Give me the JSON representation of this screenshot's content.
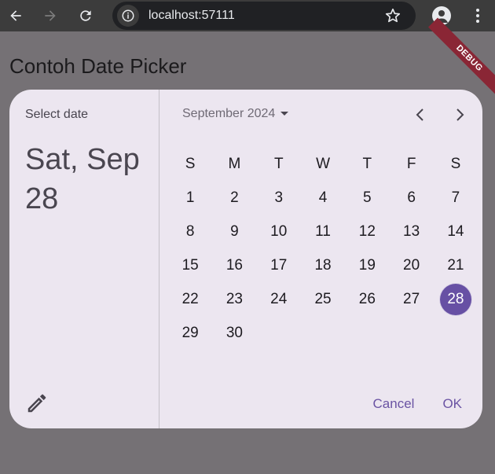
{
  "browser": {
    "url": "localhost:57111",
    "icons": [
      "back-icon",
      "forward-icon",
      "reload-icon",
      "info-icon",
      "star-icon",
      "profile-icon",
      "more-icon"
    ]
  },
  "app": {
    "title": "Contoh Date Picker",
    "debug_banner": "DEBUG"
  },
  "dialog": {
    "help_text": "Select date",
    "headline": "Sat, Sep 28",
    "month_label": "September 2024",
    "weekdays": [
      "S",
      "M",
      "T",
      "W",
      "T",
      "F",
      "S"
    ],
    "weeks": [
      [
        "1",
        "2",
        "3",
        "4",
        "5",
        "6",
        "7"
      ],
      [
        "8",
        "9",
        "10",
        "11",
        "12",
        "13",
        "14"
      ],
      [
        "15",
        "16",
        "17",
        "18",
        "19",
        "20",
        "21"
      ],
      [
        "22",
        "23",
        "24",
        "25",
        "26",
        "27",
        "28"
      ],
      [
        "29",
        "30",
        "",
        "",
        "",
        "",
        ""
      ]
    ],
    "selected_day": "28",
    "cancel_label": "Cancel",
    "ok_label": "OK"
  },
  "colors": {
    "accent": "#6750a4",
    "dialog_bg": "#ece6f0",
    "scrim": "#757175"
  }
}
